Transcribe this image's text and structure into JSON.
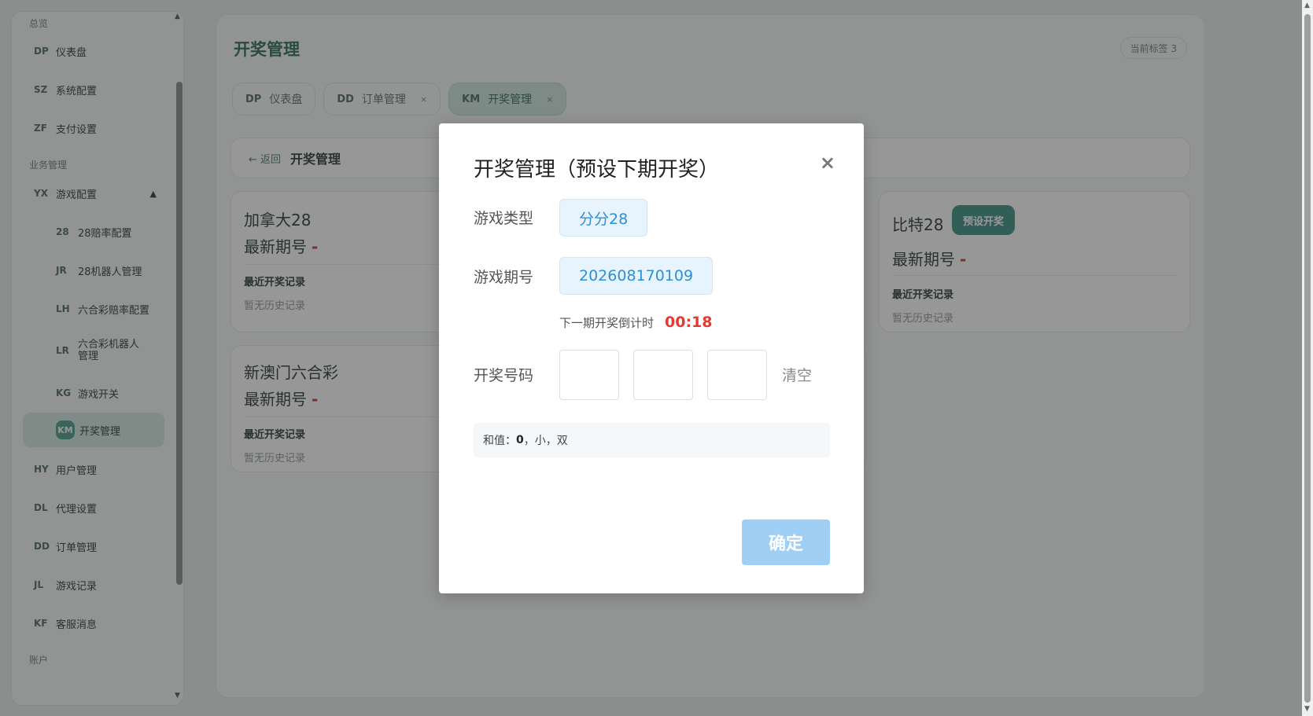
{
  "sidebar": {
    "groups": {
      "overview": "总览",
      "business": "业务管理",
      "account": "账户"
    },
    "items": [
      {
        "code": "DP",
        "label": "仪表盘"
      },
      {
        "code": "SZ",
        "label": "系统配置"
      },
      {
        "code": "ZF",
        "label": "支付设置"
      },
      {
        "code": "YX",
        "label": "游戏配置",
        "arrow": "▲"
      },
      {
        "code": "28",
        "label": "28赔率配置"
      },
      {
        "code": "JR",
        "label": "28机器人管理"
      },
      {
        "code": "LH",
        "label": "六合彩赔率配置"
      },
      {
        "code": "LR",
        "label": "六合彩机器人管理"
      },
      {
        "code": "KG",
        "label": "游戏开关"
      },
      {
        "code": "KM",
        "label": "开奖管理"
      },
      {
        "code": "HY",
        "label": "用户管理"
      },
      {
        "code": "DL",
        "label": "代理设置"
      },
      {
        "code": "DD",
        "label": "订单管理"
      },
      {
        "code": "JL",
        "label": "游戏记录"
      },
      {
        "code": "KF",
        "label": "客服消息"
      }
    ]
  },
  "header": {
    "title": "开奖管理",
    "tag_count": "当前标签 3"
  },
  "tabs": [
    {
      "code": "DP",
      "label": "仪表盘",
      "close": ""
    },
    {
      "code": "DD",
      "label": "订单管理",
      "close": "×"
    },
    {
      "code": "KM",
      "label": "开奖管理",
      "close": "×"
    }
  ],
  "crumb": {
    "back": "← 返回",
    "title": "开奖管理"
  },
  "cards": [
    {
      "game": "加拿大28",
      "latest": "最新期号",
      "dash": "-",
      "rec_label": "最近开奖记录",
      "rec_empty": "暂无历史记录"
    },
    {
      "game": "比特28",
      "latest": "最新期号",
      "dash": "-",
      "rec_label": "最近开奖记录",
      "rec_empty": "暂无历史记录",
      "preset": "预设开奖"
    },
    {
      "game": "新澳门六合彩",
      "latest": "最新期号",
      "dash": "-",
      "rec_label": "最近开奖记录",
      "rec_empty": "暂无历史记录"
    }
  ],
  "modal": {
    "title": "开奖管理（预设下期开奖）",
    "close": "×",
    "game_type_label": "游戏类型",
    "game_type_value": "分分28",
    "period_label": "游戏期号",
    "period_value": "202608170109",
    "countdown_label": "下一期开奖倒计时",
    "countdown_value": "00:18",
    "numbers_label": "开奖号码",
    "clear": "清空",
    "sum_prefix": "和值：",
    "sum_value": "0",
    "sum_suffix": "，小，双",
    "confirm": "确定"
  },
  "colors": {
    "accent": "#3f8f83",
    "countdown": "#e53935",
    "pill_text": "#2d8fd5",
    "confirm_btn": "#a0cff5"
  }
}
